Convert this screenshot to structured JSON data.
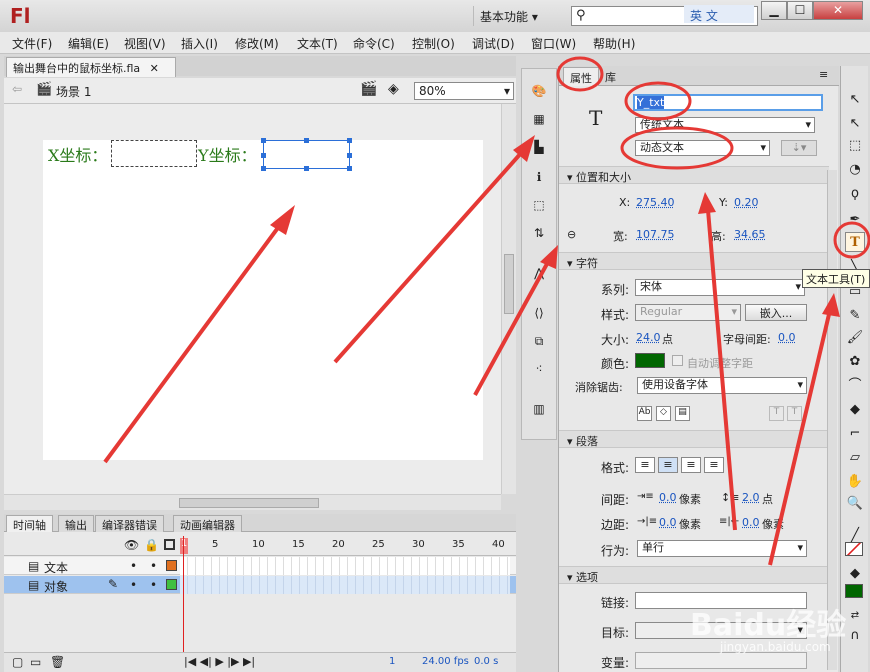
{
  "app": {
    "logo": "Fl",
    "workspace": "基本功能 ▾",
    "search_placeholder": "",
    "ime": "英 文"
  },
  "window_controls": {
    "minimize": "▁",
    "restore": "☐",
    "close": "✕"
  },
  "menu": [
    "文件(F)",
    "编辑(E)",
    "视图(V)",
    "插入(I)",
    "修改(M)",
    "文本(T)",
    "命令(C)",
    "控制(O)",
    "调试(D)",
    "窗口(W)",
    "帮助(H)"
  ],
  "doc": {
    "tab_title": "输出舞台中的鼠标坐标.fla",
    "tab_close": "✕",
    "scene": "场景 1",
    "zoom": "80%"
  },
  "stage": {
    "x_label": "X坐标：",
    "y_label": "Y坐标：",
    "text_color": "#2a7a1a"
  },
  "timeline": {
    "tabs": [
      "时间轴",
      "输出",
      "编译器错误",
      "动画编辑器"
    ],
    "frame_numbers": [
      "1",
      "5",
      "10",
      "15",
      "20",
      "25",
      "30",
      "35",
      "40"
    ],
    "layers": [
      {
        "name": "文本",
        "color": "#e07020",
        "selected": false
      },
      {
        "name": "对象",
        "color": "#40c040",
        "selected": true
      }
    ],
    "status": {
      "frame": "1",
      "fps": "24.00 fps",
      "time": "0.0 s"
    }
  },
  "properties": {
    "tabs": [
      "属性",
      "库"
    ],
    "instance_name": "Y_txt",
    "text_engine": "传统文本",
    "text_type": "动态文本",
    "sections": {
      "position": "位置和大小",
      "character": "字符",
      "paragraph": "段落",
      "options": "选项"
    },
    "x_label": "X:",
    "x_value": "275.40",
    "y_label": "Y:",
    "y_value": "0.20",
    "w_label": "宽:",
    "w_value": "107.75",
    "h_label": "高:",
    "h_value": "34.65",
    "family_label": "系列:",
    "family_value": "宋体",
    "style_label": "样式:",
    "style_value": "Regular",
    "embed_button": "嵌入...",
    "size_label": "大小:",
    "size_value": "24.0",
    "size_unit": "点",
    "spacing_label": "字母间距:",
    "spacing_value": "0.0",
    "color_label": "颜色:",
    "color_value": "#006600",
    "autokern_label": "自动调整字距",
    "antialias_label": "消除锯齿:",
    "antialias_value": "使用设备字体",
    "format_label": "格式:",
    "spacing2_label": "间距:",
    "indent_value": "0.0",
    "indent_unit": "像素",
    "line_value": "2.0",
    "line_unit": "点",
    "margin_label": "边距:",
    "margin_left": "0.0",
    "margin_left_unit": "像素",
    "margin_right": "0.0",
    "margin_right_unit": "像素",
    "behavior_label": "行为:",
    "behavior_value": "单行",
    "link_label": "链接:",
    "target_label": "目标:",
    "variable_label": "变量:"
  },
  "tooltip": "文本工具(T)",
  "watermark": {
    "brand": "Baidu经验",
    "url": "jingyan.baidu.com"
  },
  "annotation_color": "#e53935"
}
